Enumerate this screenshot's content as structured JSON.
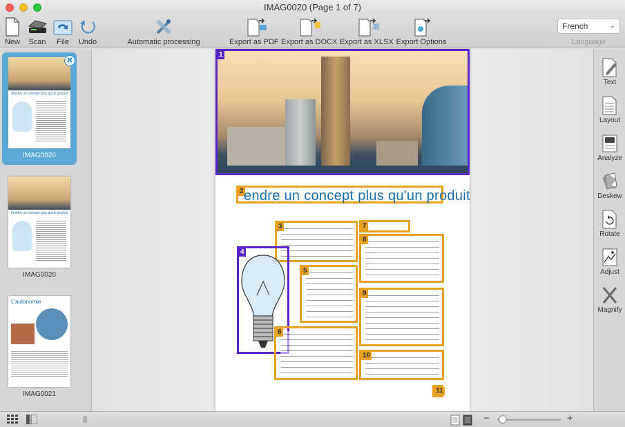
{
  "window": {
    "title": "IMAG0020 (Page 1 of 7)"
  },
  "toolbar": {
    "new_label": "New",
    "scan_label": "Scan",
    "file_label": "File",
    "undo_label": "Undo",
    "auto_label": "Automatic processing",
    "export_pdf_label": "Export as PDF",
    "export_docx_label": "Export as DOCX",
    "export_xlsx_label": "Export as XLSX",
    "export_options_label": "Export Options",
    "pdf_badge": "PDF",
    "docx_badge": "DOCX",
    "xlsx_badge": "XLSX"
  },
  "language": {
    "selected": "French",
    "label": "Language"
  },
  "thumbnails": [
    {
      "label": "IMAG0020"
    },
    {
      "label": "IMAG0020"
    },
    {
      "label": "IMAG0021"
    }
  ],
  "thumb_headlines": [
    "Vendre un concept plus qu'un produit",
    "L'autonomie"
  ],
  "page": {
    "headline": "endre un concept plus qu'un produit",
    "zones": [
      "1",
      "2",
      "3",
      "4",
      "5",
      "6",
      "7",
      "8",
      "9",
      "10",
      "11"
    ]
  },
  "rightbar": {
    "text_label": "Text",
    "layout_label": "Layout",
    "analyze_label": "Analyze",
    "deskew_label": "Deskew",
    "rotate_label": "Rotate",
    "adjust_label": "Adjust",
    "magnify_label": "Magnify"
  },
  "status": {
    "zoom_minus": "−",
    "zoom_plus": "+"
  },
  "colors": {
    "selection": "#5aa9d8",
    "image_zone": "#5a23c8",
    "text_zone": "#e8a020"
  }
}
